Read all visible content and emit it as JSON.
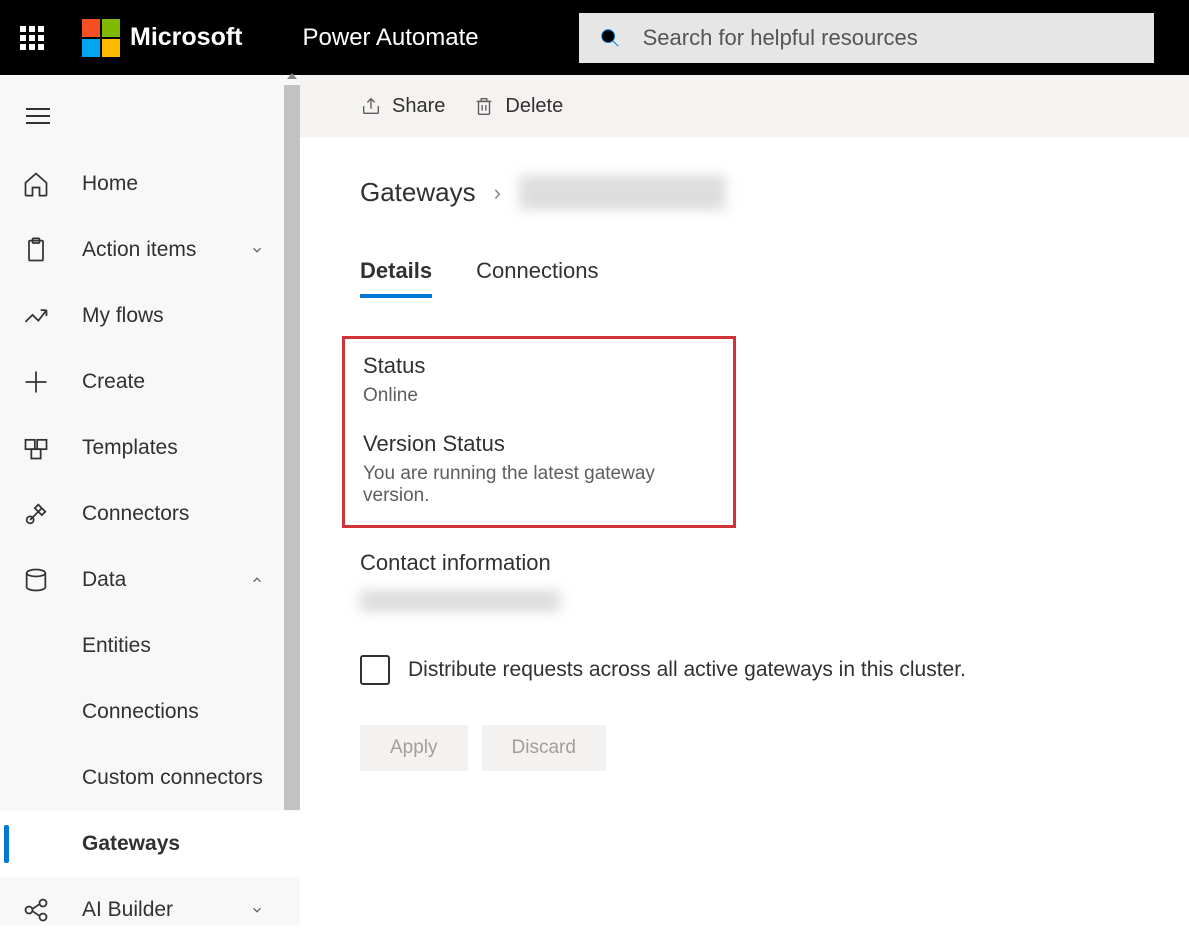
{
  "header": {
    "brand": "Microsoft",
    "product": "Power Automate",
    "search_placeholder": "Search for helpful resources"
  },
  "sidebar": {
    "items": [
      {
        "label": "Home",
        "icon": "home"
      },
      {
        "label": "Action items",
        "icon": "clipboard",
        "expandable": true,
        "expanded": false
      },
      {
        "label": "My flows",
        "icon": "flow"
      },
      {
        "label": "Create",
        "icon": "plus"
      },
      {
        "label": "Templates",
        "icon": "templates"
      },
      {
        "label": "Connectors",
        "icon": "connector"
      },
      {
        "label": "Data",
        "icon": "database",
        "expandable": true,
        "expanded": true
      },
      {
        "label": "AI Builder",
        "icon": "ai",
        "expandable": true,
        "expanded": false
      }
    ],
    "data_subitems": [
      {
        "label": "Entities"
      },
      {
        "label": "Connections"
      },
      {
        "label": "Custom connectors"
      },
      {
        "label": "Gateways",
        "active": true
      }
    ]
  },
  "actionbar": {
    "share": "Share",
    "delete": "Delete"
  },
  "breadcrumb": {
    "root": "Gateways"
  },
  "tabs": {
    "details": "Details",
    "connections": "Connections"
  },
  "details": {
    "status_label": "Status",
    "status_value": "Online",
    "version_status_label": "Version Status",
    "version_status_value": "You are running the latest gateway version.",
    "contact_label": "Contact information",
    "distribute_label": "Distribute requests across all active gateways in this cluster.",
    "apply": "Apply",
    "discard": "Discard"
  }
}
